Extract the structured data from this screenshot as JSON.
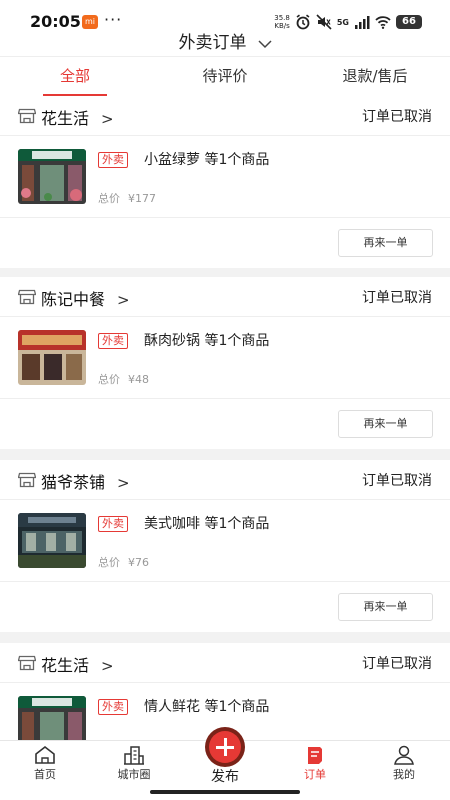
{
  "status_bar": {
    "time": "20:05",
    "mi_badge": "mi",
    "dots": "···",
    "speed_value": "35.8",
    "speed_unit": "KB/s",
    "network": "5G",
    "battery": "66"
  },
  "header": {
    "title": "外卖订单"
  },
  "tabs": [
    {
      "label": "全部",
      "active": true
    },
    {
      "label": "待评价",
      "active": false
    },
    {
      "label": "退款/售后",
      "active": false
    }
  ],
  "orders": [
    {
      "shop": "花生活",
      "arrow": ">",
      "status": "订单已取消",
      "badge": "外卖",
      "item": "小盆绿萝 等1个商品",
      "price_label": "总价",
      "price": "¥177",
      "reorder_label": "再来一单"
    },
    {
      "shop": "陈记中餐",
      "arrow": ">",
      "status": "订单已取消",
      "badge": "外卖",
      "item": "酥肉砂锅 等1个商品",
      "price_label": "总价",
      "price": "¥48",
      "reorder_label": "再来一单"
    },
    {
      "shop": "猫爷茶铺",
      "arrow": ">",
      "status": "订单已取消",
      "badge": "外卖",
      "item": "美式咖啡 等1个商品",
      "price_label": "总价",
      "price": "¥76",
      "reorder_label": "再来一单"
    },
    {
      "shop": "花生活",
      "arrow": ">",
      "status": "订单已取消",
      "badge": "外卖",
      "item": "情人鲜花 等1个商品",
      "price_label": "总价",
      "price": "",
      "reorder_label": ""
    }
  ],
  "bottom_nav": {
    "home": "首页",
    "city": "城市圈",
    "publish": "发布",
    "orders": "订单",
    "me": "我的"
  },
  "colors": {
    "accent": "#e53935",
    "divider": "#f2f2f2"
  }
}
